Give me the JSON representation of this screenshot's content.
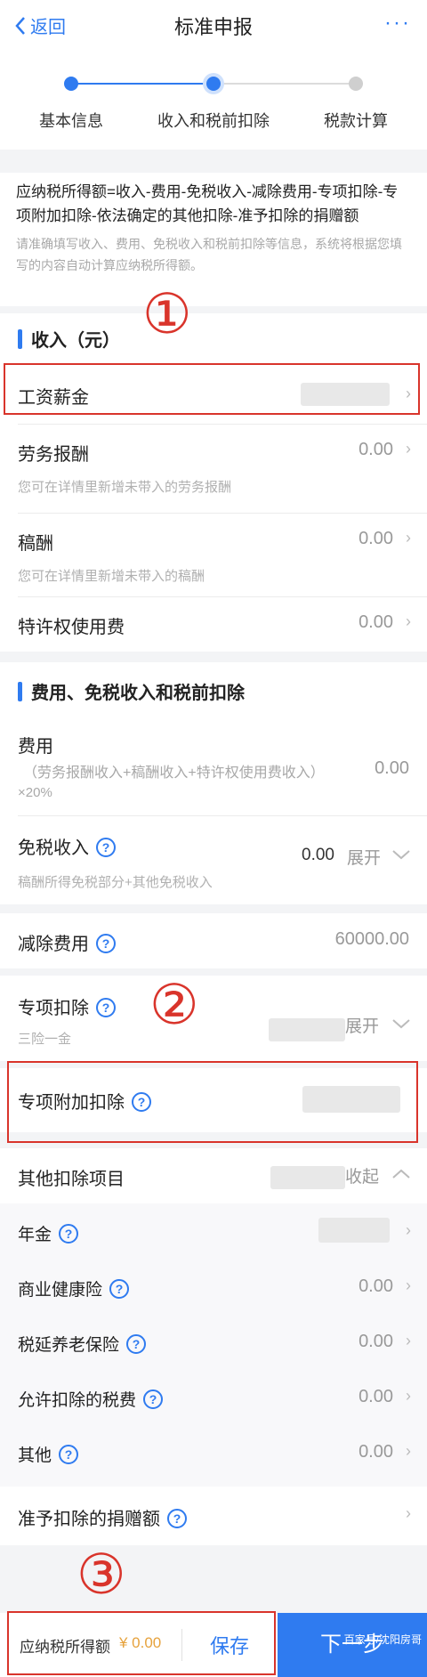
{
  "header": {
    "back_label": "返回",
    "title": "标准申报",
    "more": "···"
  },
  "stepper": {
    "steps": [
      {
        "label": "基本信息",
        "state": "done"
      },
      {
        "label": "收入和税前扣除",
        "state": "current"
      },
      {
        "label": "税款计算",
        "state": "todo"
      }
    ]
  },
  "formula": {
    "main": "应纳税所得额=收入-费用-免税收入-减除费用-专项扣除-专项附加扣除-依法确定的其他扣除-准予扣除的捐赠额",
    "hint": "请准确填写收入、费用、免税收入和税前扣除等信息，系统将根据您填写的内容自动计算应纳税所得额。"
  },
  "annotations": {
    "one": "①",
    "two": "②",
    "three": "③"
  },
  "income": {
    "title": "收入（元）",
    "items": [
      {
        "label": "工资薪金",
        "value": ""
      },
      {
        "label": "劳务报酬",
        "value": "0.00",
        "sub": "您可在详情里新增未带入的劳务报酬"
      },
      {
        "label": "稿酬",
        "value": "0.00",
        "sub": "您可在详情里新增未带入的稿酬"
      },
      {
        "label": "特许权使用费",
        "value": "0.00"
      }
    ]
  },
  "deductions": {
    "title": "费用、免税收入和税前扣除",
    "fee_label": "费用",
    "fee_sub1": "（劳务报酬收入+稿酬收入+特许权使用费收入）",
    "fee_sub2": "×20%",
    "fee_value": "0.00",
    "taxfree_label": "免税收入",
    "taxfree_value": "0.00",
    "taxfree_toggle": "展开",
    "taxfree_sub": "稿酬所得免税部分+其他免税收入",
    "reduce_label": "减除费用",
    "reduce_value": "60000.00",
    "special_label": "专项扣除",
    "special_sub": "三险一金",
    "special_toggle": "展开",
    "addl_label": "专项附加扣除",
    "other_label": "其他扣除项目",
    "other_toggle": "收起",
    "other_items": [
      {
        "label": "年金",
        "value": ""
      },
      {
        "label": "商业健康险",
        "value": "0.00"
      },
      {
        "label": "税延养老保险",
        "value": "0.00"
      },
      {
        "label": "允许扣除的税费",
        "value": "0.00"
      },
      {
        "label": "其他",
        "value": "0.00"
      }
    ],
    "donation_label": "准予扣除的捐赠额"
  },
  "footer": {
    "taxable_label": "应纳税所得额",
    "taxable_value": "¥ 0.00",
    "save_label": "保存",
    "next_label": "下一步",
    "watermark": "百家号/沈阳房哥"
  },
  "colors": {
    "accent": "#2f7bf0",
    "annotation": "#d9342b",
    "amount": "#e6a23c"
  }
}
